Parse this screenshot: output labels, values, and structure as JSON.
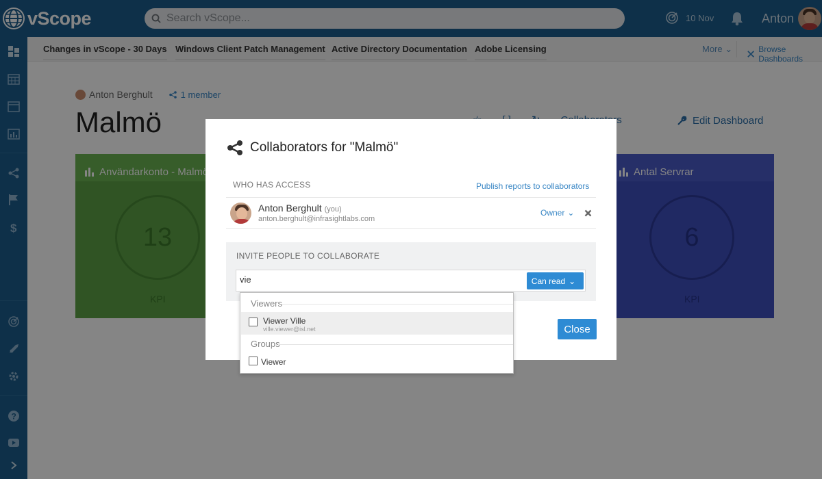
{
  "app": {
    "brand": "vScope",
    "search_placeholder": "Search vScope...",
    "date": "10 Nov",
    "user_name": "Anton"
  },
  "dashboard_tabs": [
    {
      "label": "Changes in vScope - 30 Days"
    },
    {
      "label": "Windows Client Patch Management"
    },
    {
      "label": "Active Directory Documentation"
    },
    {
      "label": "Adobe Licensing"
    }
  ],
  "tabs_more": "More",
  "browse_dashboards": "Browse Dashboards",
  "dashboard": {
    "owner": "Anton Berghult",
    "members": "1 member",
    "title": "Malmö",
    "collaborators_label": "Collaborators",
    "edit_label": "Edit Dashboard"
  },
  "widgets": [
    {
      "title": "Användarkonto - Malmö",
      "value": "13",
      "kpi": "KPI",
      "color": "#5da245"
    },
    {
      "title": "Antal Servrar",
      "value": "6",
      "kpi": "KPI",
      "color": "#3f4fbf"
    }
  ],
  "modal": {
    "title": "Collaborators for \"Malmö\"",
    "who_has_access": "WHO HAS ACCESS",
    "publish_link": "Publish reports to collaborators",
    "collaborator": {
      "name": "Anton Berghult",
      "you": "(you)",
      "email": "anton.berghult@infrasightlabs.com",
      "role": "Owner"
    },
    "invite_title": "INVITE PEOPLE TO COLLABORATE",
    "invite_value": "vie",
    "permission": "Can read",
    "close": "Close"
  },
  "dropdown": {
    "groups": [
      {
        "label": "Viewers",
        "items": [
          {
            "name": "Viewer Ville",
            "email": "ville.viewer@isl.net",
            "checked": false
          }
        ]
      },
      {
        "label": "Groups",
        "items": [
          {
            "name": "Viewer",
            "checked": false
          }
        ]
      }
    ]
  },
  "colors": {
    "topbar": "#1b5d8c",
    "accent": "#2e8bd4",
    "link": "#3a87c5"
  }
}
